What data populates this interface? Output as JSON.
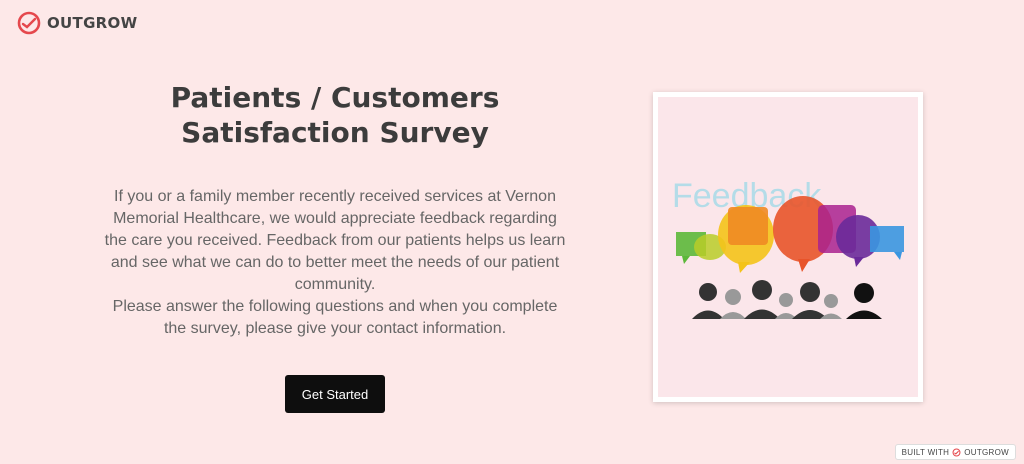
{
  "brand": {
    "name": "OUTGROW",
    "logo_icon": "outgrow-logo-icon",
    "accent_color": "#e5484d"
  },
  "survey": {
    "title": "Patients / Customers Satisfaction Survey",
    "intro_1": "If you or a family member recently received services at Vernon Memorial Healthcare, we would appreciate feedback regarding the care you received. Feedback from our patients helps us learn and see what we can do to better meet the needs of our patient community.",
    "intro_2": "Please answer the following questions and when you complete the survey, please give your contact information.",
    "cta_label": "Get Started",
    "cta_color": "#0e0e0e"
  },
  "illustration": {
    "word": "Feedback",
    "icon": "feedback-people-illustration"
  },
  "footer": {
    "built_with": "BUILT WITH",
    "brand": "OUTGROW"
  },
  "colors": {
    "background": "#fde8e8"
  }
}
